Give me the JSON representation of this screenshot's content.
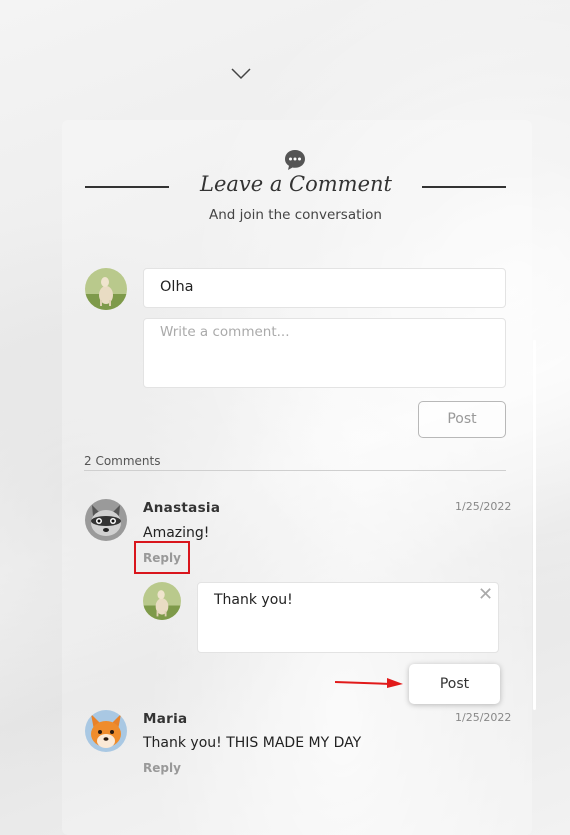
{
  "header": {
    "title": "Leave a Comment",
    "subtitle": "And join the conversation"
  },
  "form": {
    "name_value": "Olha",
    "comment_placeholder": "Write a comment...",
    "post_label": "Post"
  },
  "comments_count": "2 Comments",
  "comments": [
    {
      "author": "Anastasia",
      "date": "1/25/2022",
      "text": "Amazing!",
      "reply_label": "Reply",
      "avatar": "raccoon-avatar"
    },
    {
      "author": "Maria",
      "date": "1/25/2022",
      "text": "Thank you! THIS MADE MY DAY",
      "reply_label": "Reply",
      "avatar": "fox-avatar"
    }
  ],
  "reply_form": {
    "value": "Thank you!",
    "post_label": "Post"
  },
  "icons": [
    "chevron-down-icon",
    "chat-bubble-icon",
    "close-icon",
    "arrow-icon"
  ],
  "colors": {
    "highlight": "#d9151c",
    "text": "#333333"
  }
}
